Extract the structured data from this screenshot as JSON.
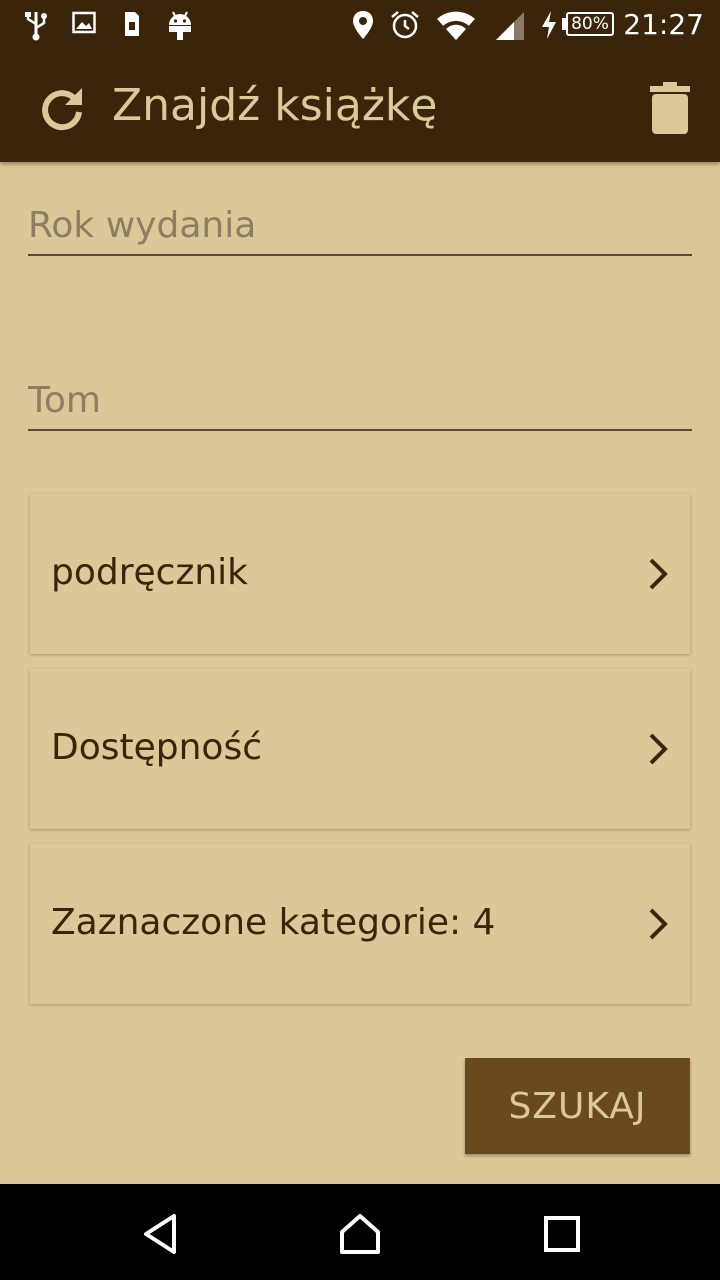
{
  "status_bar": {
    "battery": "80%",
    "time": "21:27",
    "icons": [
      "usb-icon",
      "image-icon",
      "sim-icon",
      "android-icon",
      "location-icon",
      "alarm-icon",
      "wifi-icon",
      "signal-icon",
      "charging-icon",
      "battery-icon"
    ]
  },
  "toolbar": {
    "title": "Znajdź książkę",
    "refresh_icon": "refresh-icon",
    "delete_icon": "trash-icon"
  },
  "form": {
    "year_placeholder": "Rok wydania",
    "year_value": "",
    "volume_placeholder": "Tom",
    "volume_value": ""
  },
  "selectors": [
    {
      "label": "podręcznik"
    },
    {
      "label": "Dostępność"
    },
    {
      "label": "Zaznaczone kategorie: 4"
    }
  ],
  "search_button": "SZUKAJ",
  "colors": {
    "primary_dark": "#3b250a",
    "background": "#dbc797",
    "accent": "#6a491e",
    "title_text": "#dcc99a"
  },
  "nav_bar": {
    "icons": [
      "back-icon",
      "home-icon",
      "recents-icon"
    ]
  }
}
